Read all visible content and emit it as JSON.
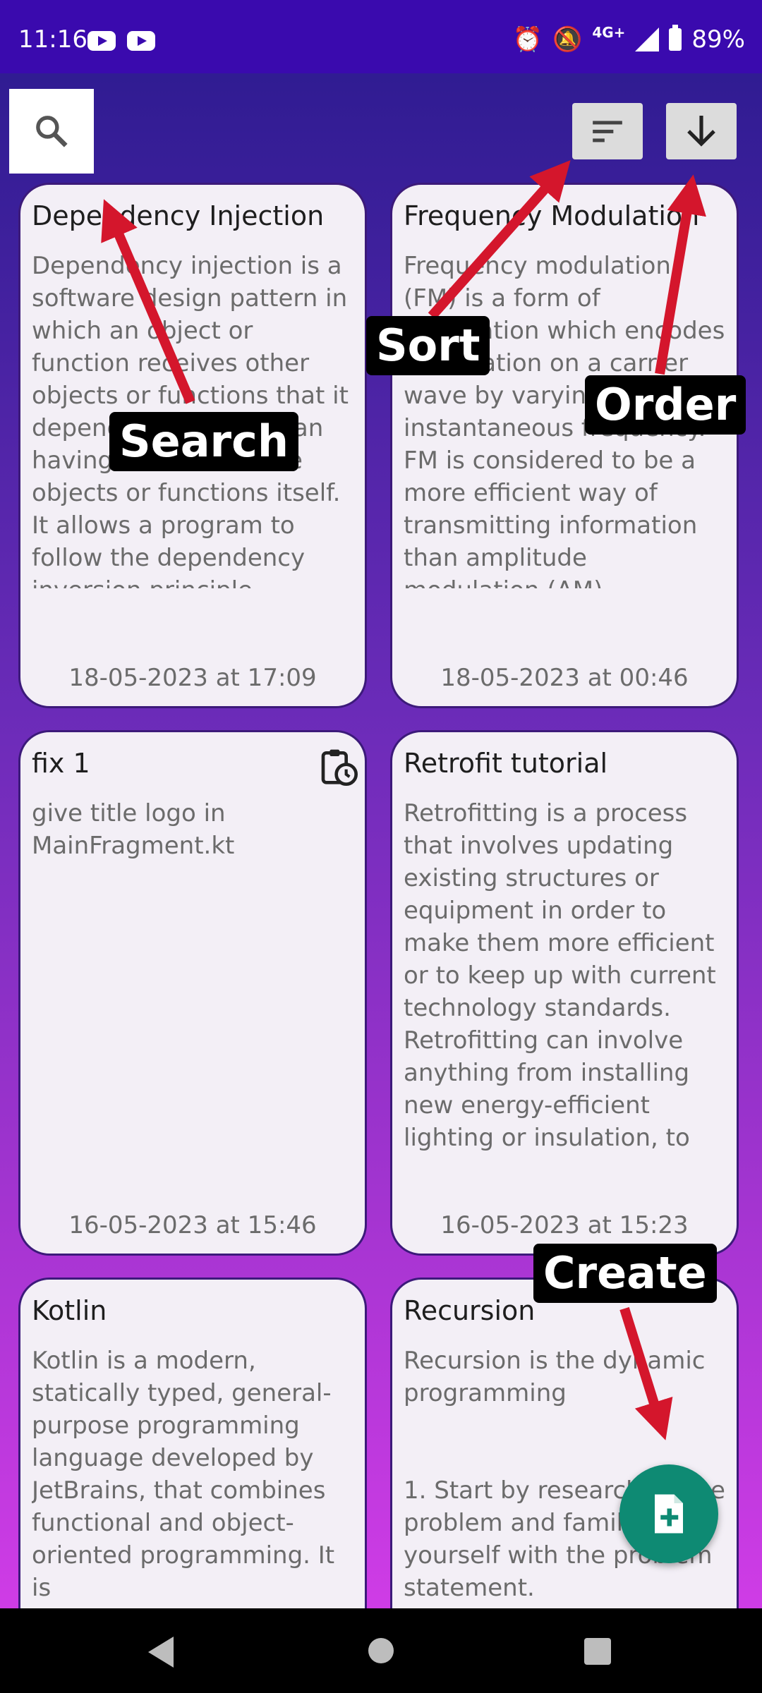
{
  "status_bar": {
    "time": "11:16",
    "network": "4G+",
    "battery": "89%",
    "icons": [
      "youtube-icon",
      "youtube-icon",
      "alarm-icon",
      "notifications-off-icon",
      "signal-icon",
      "battery-icon"
    ]
  },
  "toolbar": {
    "search_icon": "search-icon",
    "sort_icon": "sort-icon",
    "order_icon": "arrow-down-icon"
  },
  "notes": [
    {
      "title": "Dependency Injection",
      "body": "Dependency injection is a software design pattern in which an object or function receives other objects or functions that it depends on, rather than having to create those objects or functions itself. It allows a program to follow the dependency inversion principle.",
      "date": "18-05-2023 at 17:09"
    },
    {
      "title": "Frequency Modulation",
      "body": "Frequency modulation (FM) is a form of modulation which encodes information on a carrier wave by varying the instantaneous frequency. FM is considered to be a more efficient way of transmitting information than amplitude modulation (AM)",
      "date": "18-05-2023 at 00:46"
    },
    {
      "title": "fix 1",
      "body": "give title logo in MainFragment.kt",
      "date": "16-05-2023 at 15:46",
      "reminder_icon": "clipboard-clock-icon"
    },
    {
      "title": "Retrofit tutorial",
      "body": "Retrofitting is a process that involves updating existing structures or equipment in order to make them more efficient or to keep up with current technology standards. Retrofitting can involve anything from installing new energy-efficient lighting or insulation, to",
      "date": "16-05-2023 at 15:23"
    },
    {
      "title": "Kotlin",
      "body": "Kotlin is a modern, statically typed, general-purpose programming language developed by JetBrains, that combines functional and object-oriented programming. It is",
      "date": ""
    },
    {
      "title": "Recursion",
      "body": "Recursion is the dynamic programming\n\n\n1. Start by researching the problem and familiarize yourself with the problem statement.",
      "date": ""
    }
  ],
  "fab": {
    "icon": "note-add-icon"
  },
  "callouts": {
    "search": "Search",
    "sort": "Sort",
    "order": "Order",
    "create": "Create"
  },
  "colors": {
    "status_bar": "#3a0aae",
    "card_bg": "#f3eff6",
    "card_border": "#3c1a7a",
    "fab": "#0e8a73",
    "arrow": "#d4162c"
  }
}
